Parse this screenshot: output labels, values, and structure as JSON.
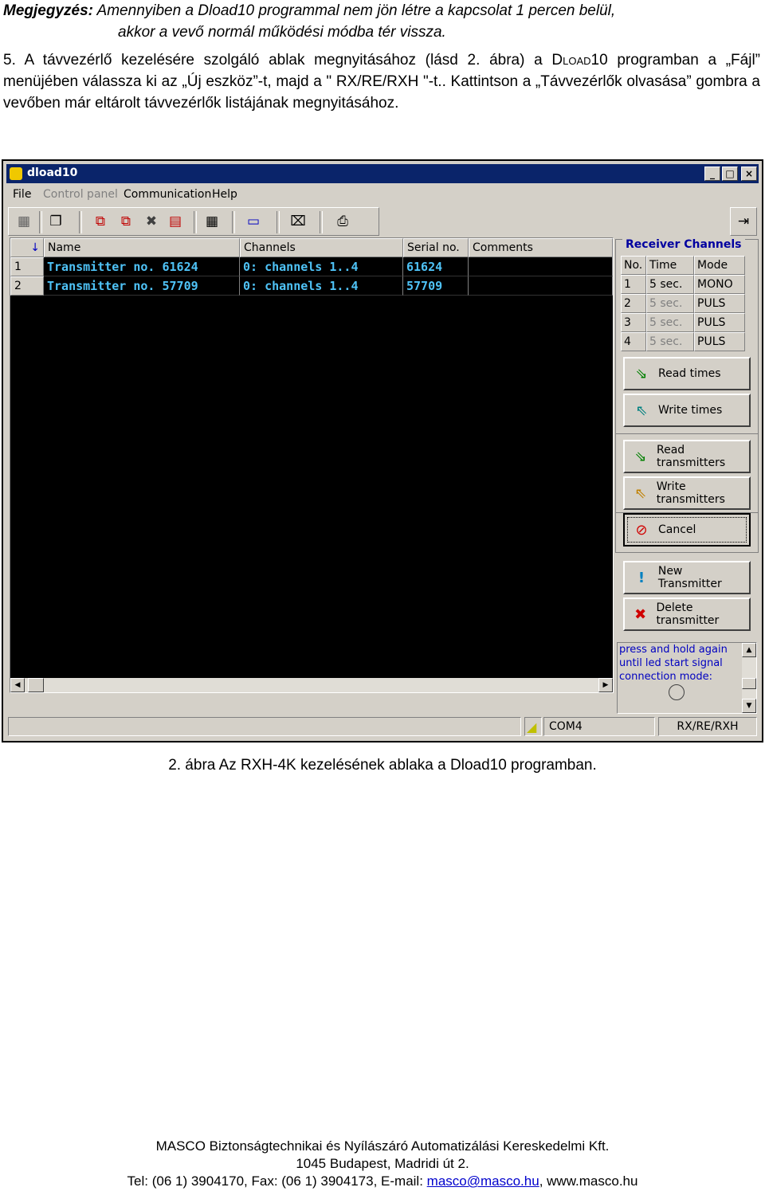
{
  "note": {
    "label": "Megjegyzés:",
    "line1": " Amennyiben a Dload10 programmal nem jön létre a kapcsolat 1 percen belül,",
    "line2": "akkor a vevő normál működési módba tér vissza."
  },
  "step": {
    "part1": "5. A távvezérlő kezelésére szolgáló ablak megnyitásához (lásd 2. ábra) a ",
    "brand": "Dload10",
    "part2": " programban a „Fájl” menüjében válassza ki az „Új eszköz”-t, majd a \" RX/RE/RXH \"-t.. Kattintson a „Távvezérlők olvasása” gombra a vevőben már eltárolt távvezérlők listájának megnyitásához."
  },
  "window": {
    "title": "dload10",
    "menu": [
      "File",
      "Control panel",
      "Communication",
      "Help"
    ],
    "grid": {
      "headers": [
        "Name",
        "Channels",
        "Serial no.",
        "Comments"
      ],
      "rows": [
        {
          "num": "1",
          "name": "Transmitter no. 61624",
          "channels": "0: channels 1..4",
          "serial": "61624",
          "comments": ""
        },
        {
          "num": "2",
          "name": "Transmitter no. 57709",
          "channels": "0: channels 1..4",
          "serial": "57709",
          "comments": ""
        }
      ]
    },
    "receiver": {
      "title": "Receiver Channels",
      "headers": [
        "No.",
        "Time",
        "Mode"
      ],
      "rows": [
        {
          "no": "1",
          "time": "5 sec.",
          "mode": "MONO"
        },
        {
          "no": "2",
          "time": "5 sec.",
          "mode": "PULS"
        },
        {
          "no": "3",
          "time": "5 sec.",
          "mode": "PULS"
        },
        {
          "no": "4",
          "time": "5 sec.",
          "mode": "PULS"
        }
      ]
    },
    "buttons": {
      "read_times": "Read times",
      "write_times": "Write times",
      "read_transmitters": "Read transmitters",
      "write_transmitters": "Write transmitters",
      "cancel": "Cancel",
      "new_transmitter": "New Transmitter",
      "delete_transmitter": "Delete transmitter"
    },
    "info_text": "press and hold again until led start signal connection mode:",
    "status": {
      "port": "COM4",
      "device": "RX/RE/RXH"
    }
  },
  "caption": "2. ábra Az RXH-4K kezelésének ablaka a Dload10 programban.",
  "footer": {
    "company": "MASCO Biztonságtechnikai és Nyílászáró Automatizálási Kereskedelmi Kft.",
    "address": "1045 Budapest, Madridi út 2.",
    "contact_prefix": "Tel: (06 1) 3904170, Fax: (06 1) 3904173, E-mail: ",
    "email": "masco@masco.hu",
    "contact_suffix": ", www.masco.hu"
  },
  "colors": {
    "titlebar": "#0a246a",
    "grid_text": "#4fc3f7",
    "grid_bg": "#000000",
    "panel_title": "#0000a0"
  }
}
